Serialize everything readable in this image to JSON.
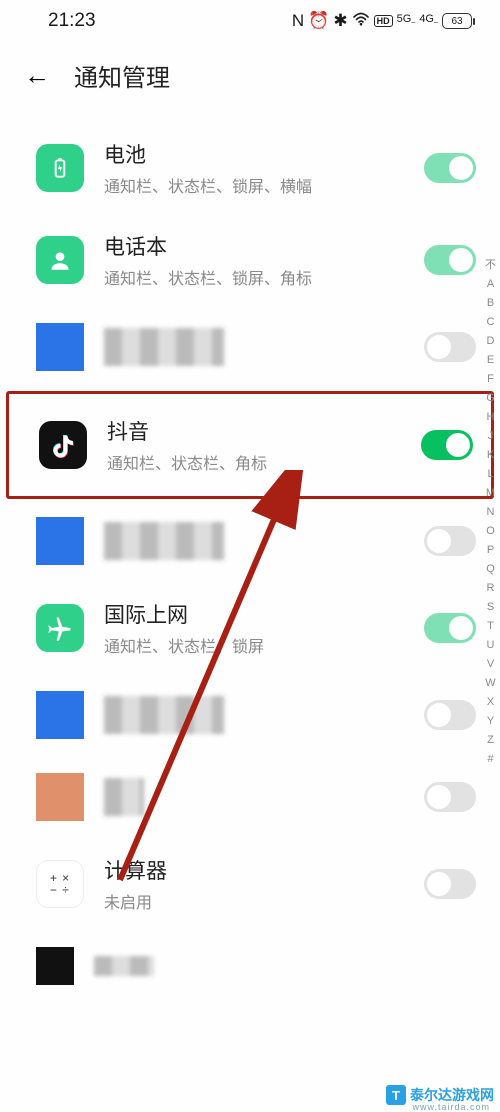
{
  "status": {
    "time": "21:23",
    "battery": "63"
  },
  "header": {
    "title": "通知管理"
  },
  "apps": [
    {
      "name": "电池",
      "sub": "通知栏、状态栏、锁屏、横幅",
      "on": true
    },
    {
      "name": "电话本",
      "sub": "通知栏、状态栏、锁屏、角标",
      "on": true
    },
    {
      "name": "",
      "sub": "",
      "on": false
    },
    {
      "name": "抖音",
      "sub": "通知栏、状态栏、角标",
      "on": true
    },
    {
      "name": "",
      "sub": "",
      "on": false
    },
    {
      "name": "国际上网",
      "sub": "通知栏、状态栏、锁屏",
      "on": true
    },
    {
      "name": "",
      "sub": "",
      "on": false
    },
    {
      "name": "",
      "sub": "",
      "on": false
    },
    {
      "name": "计算器",
      "sub": "未启用",
      "on": false
    },
    {
      "name": "",
      "sub": "",
      "on": false
    }
  ],
  "alpha": [
    "不",
    "A",
    "B",
    "C",
    "D",
    "E",
    "F",
    "G",
    "H",
    "J",
    "K",
    "L",
    "M",
    "N",
    "O",
    "P",
    "Q",
    "R",
    "S",
    "T",
    "U",
    "V",
    "W",
    "X",
    "Y",
    "Z",
    "#"
  ],
  "watermark": {
    "text": "泰尔达游戏网",
    "url": "www.tairda.com"
  }
}
